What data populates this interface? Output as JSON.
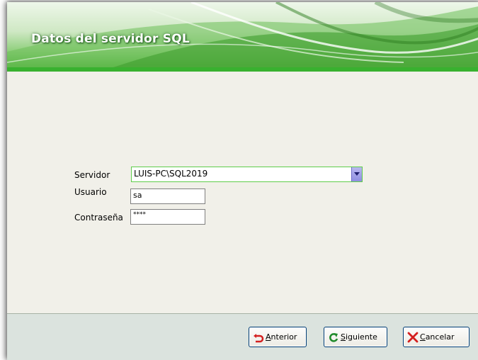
{
  "banner": {
    "title": "Datos del servidor SQL"
  },
  "form": {
    "servidor_label": "Servidor",
    "servidor_value": "LUIS-PC\\SQL2019",
    "usuario_label": "Usuario",
    "usuario_value": "sa",
    "contrasena_label": "Contraseña",
    "contrasena_value": "****"
  },
  "buttons": {
    "anterior": {
      "mnemonic": "A",
      "rest": "nterior"
    },
    "siguiente": {
      "mnemonic": "S",
      "rest": "iguiente"
    },
    "cancelar": {
      "mnemonic": "C",
      "rest": "ancelar"
    }
  },
  "icons": {
    "anterior": "back-arrow-icon",
    "siguiente": "refresh-arrow-icon",
    "cancelar": "red-x-icon",
    "combo": "dropdown-arrow-icon"
  },
  "colors": {
    "accent_green": "#39b12f",
    "combo_border": "#5fcd4a",
    "combo_button": "#8f8ee0"
  }
}
